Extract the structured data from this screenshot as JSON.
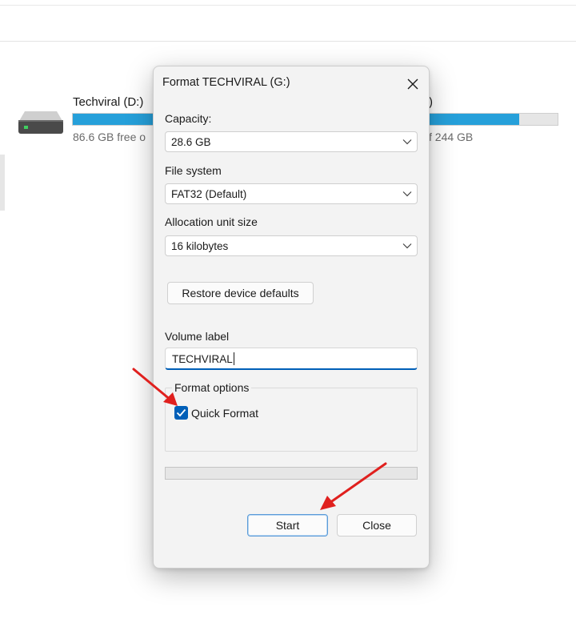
{
  "explorer": {
    "drive_left": {
      "name": "Techviral (D:)",
      "free_text": "86.6 GB free o",
      "used_fraction": 0.92
    },
    "drive_right": {
      "name_fragment": ")",
      "total_text": "f 244 GB"
    },
    "icon": "hard-drive-icon"
  },
  "dialog": {
    "title": "Format TECHVIRAL (G:)",
    "close_icon": "close-icon",
    "capacity": {
      "label": "Capacity:",
      "value": "28.6 GB"
    },
    "file_system": {
      "label": "File system",
      "value": "FAT32 (Default)"
    },
    "allocation": {
      "label": "Allocation unit size",
      "value": "16 kilobytes"
    },
    "restore_label": "Restore device defaults",
    "volume": {
      "label": "Volume label",
      "value": "TECHVIRAL"
    },
    "format_options": {
      "title": "Format options",
      "quick_format": "Quick Format",
      "quick_format_checked": true
    },
    "progress": 0,
    "start_label": "Start",
    "close_label": "Close"
  },
  "colors": {
    "accent": "#005fb8",
    "drive_bar": "#26a0da",
    "annotation_arrow": "#e0201e"
  }
}
